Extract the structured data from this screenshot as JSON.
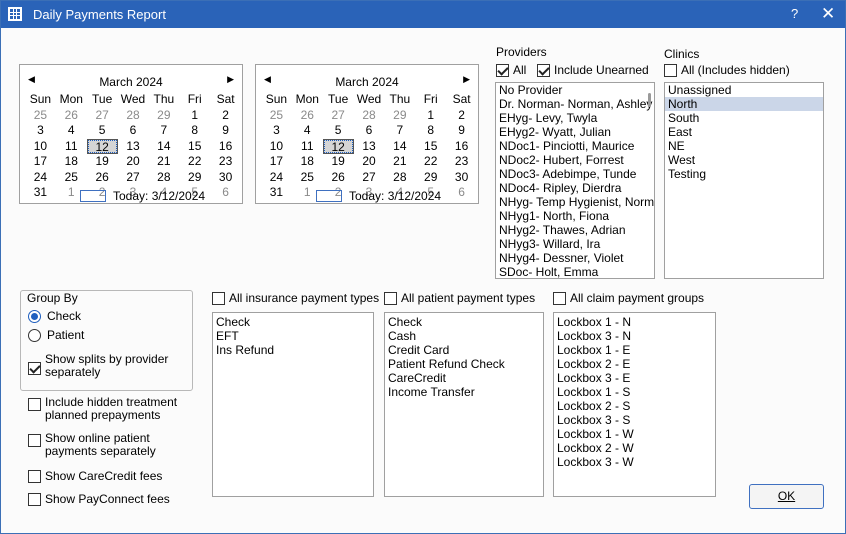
{
  "window": {
    "title": "Daily Payments Report",
    "help": "?",
    "close": "✕"
  },
  "calendars": [
    {
      "month": "March 2024",
      "days_header": [
        "Sun",
        "Mon",
        "Tue",
        "Wed",
        "Thu",
        "Fri",
        "Sat"
      ],
      "rows": [
        [
          "25",
          "26",
          "27",
          "28",
          "29",
          "1",
          "2"
        ],
        [
          "3",
          "4",
          "5",
          "6",
          "7",
          "8",
          "9"
        ],
        [
          "10",
          "11",
          "12",
          "13",
          "14",
          "15",
          "16"
        ],
        [
          "17",
          "18",
          "19",
          "20",
          "21",
          "22",
          "23"
        ],
        [
          "24",
          "25",
          "26",
          "27",
          "28",
          "29",
          "30"
        ],
        [
          "31",
          "1",
          "2",
          "3",
          "4",
          "5",
          "6"
        ]
      ],
      "selected": "12",
      "today_label": "Today: 3/12/2024"
    },
    {
      "month": "March 2024",
      "days_header": [
        "Sun",
        "Mon",
        "Tue",
        "Wed",
        "Thu",
        "Fri",
        "Sat"
      ],
      "rows": [
        [
          "25",
          "26",
          "27",
          "28",
          "29",
          "1",
          "2"
        ],
        [
          "3",
          "4",
          "5",
          "6",
          "7",
          "8",
          "9"
        ],
        [
          "10",
          "11",
          "12",
          "13",
          "14",
          "15",
          "16"
        ],
        [
          "17",
          "18",
          "19",
          "20",
          "21",
          "22",
          "23"
        ],
        [
          "24",
          "25",
          "26",
          "27",
          "28",
          "29",
          "30"
        ],
        [
          "31",
          "1",
          "2",
          "3",
          "4",
          "5",
          "6"
        ]
      ],
      "selected": "12",
      "today_label": "Today: 3/12/2024"
    }
  ],
  "providers": {
    "label": "Providers",
    "all_label": "All",
    "all_checked": true,
    "include_unearned_label": "Include Unearned",
    "include_unearned_checked": true,
    "items": [
      "No Provider",
      "Dr. Norman- Norman, Ashley",
      "EHyg- Levy, Twyla",
      "EHyg2- Wyatt, Julian",
      "NDoc1- Pinciotti, Maurice",
      "NDoc2- Hubert, Forrest",
      "NDoc3- Adebimpe, Tunde",
      "NDoc4- Ripley, Dierdra",
      "NHyg- Temp Hygienist, Normal",
      "NHyg1- North, Fiona",
      "NHyg2- Thawes, Adrian",
      "NHyg3- Willard, Ira",
      "NHyg4- Dessner, Violet",
      "SDoc- Holt, Emma"
    ]
  },
  "clinics": {
    "label": "Clinics",
    "all_label": "All (Includes hidden)",
    "all_checked": false,
    "items": [
      "Unassigned",
      "North",
      "South",
      "East",
      "NE",
      "West",
      "Testing"
    ],
    "selected": "North"
  },
  "group_by": {
    "label": "Group By",
    "options": [
      "Check",
      "Patient"
    ],
    "selected": "Check",
    "show_splits_label": "Show splits by provider separately",
    "show_splits_checked": true
  },
  "options": {
    "hidden_prepayments": "Include hidden treatment planned prepayments",
    "online_payments": "Show online patient payments separately",
    "carecredit_fees": "Show CareCredit fees",
    "payconnect_fees": "Show PayConnect fees"
  },
  "insurance_types": {
    "all_label": "All insurance payment types",
    "items": [
      "Check",
      "EFT",
      "Ins Refund"
    ]
  },
  "patient_types": {
    "all_label": "All patient payment types",
    "items": [
      "Check",
      "Cash",
      "Credit Card",
      "Patient Refund Check",
      "CareCredit",
      "Income Transfer"
    ]
  },
  "claim_groups": {
    "all_label": "All claim payment groups",
    "items": [
      "Lockbox 1 - N",
      "Lockbox 3 - N",
      "Lockbox 1 - E",
      "Lockbox 2 - E",
      "Lockbox 3 - E",
      "Lockbox 1 - S",
      "Lockbox 2 - S",
      "Lockbox 3 - S",
      "Lockbox 1 - W",
      "Lockbox 2 - W",
      "Lockbox 3 - W"
    ]
  },
  "ok_button": "OK"
}
